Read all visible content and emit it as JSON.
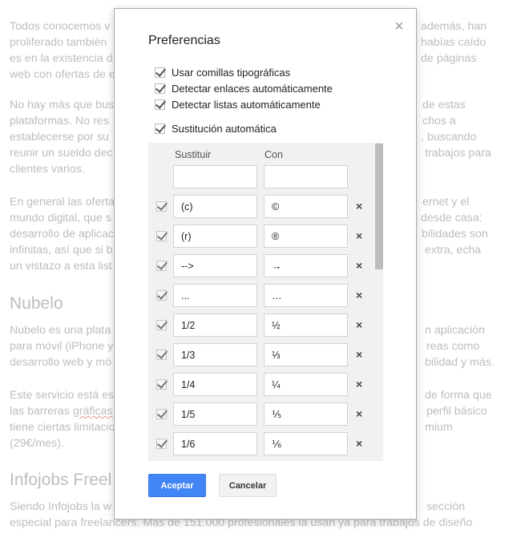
{
  "article": {
    "paragraphs": [
      "Todos conocemos v                                                            además, han proliferado también                                                  habías caído es en la existencia d                                             de páginas web con ofertas de e",
      "No hay más que bus                                                            de estas plataformas. No res                                                     chos a establecerse por su                                                     , buscando reunir un sueldo dec                                              trabajos para clientes varios.",
      "En general las oferta                                                          ernet y el mundo digital, que s                                                  desde casa: desarrollo de aplicac                                             bilidades son infinitas, así que si b                                         extra, echa un vistazo a esta list"
    ],
    "lines": [
      [
        "Todos conocemos v",
        "además, han"
      ],
      [
        "proliferado también",
        "habías caído"
      ],
      [
        "es en la existencia d",
        "de páginas"
      ],
      [
        "web con ofertas de e",
        ""
      ],
      [
        "No hay más que bus",
        "de estas"
      ],
      [
        "plataformas. No res",
        "chos a"
      ],
      [
        "establecerse por su",
        ", buscando"
      ],
      [
        "reunir un sueldo dec",
        "trabajos para"
      ],
      [
        "clientes varios.",
        ""
      ],
      [
        "En general las oferta",
        "ernet y el"
      ],
      [
        "mundo digital, que s",
        "desde casa:"
      ],
      [
        "desarrollo de aplicac",
        "bilidades son"
      ],
      [
        "infinitas, así que si b",
        "extra, echa"
      ],
      [
        "un vistazo a esta list",
        ""
      ],
      [
        "Nubelo es una plata",
        "n aplicación"
      ],
      [
        "para móvil (iPhone y",
        "reas como"
      ],
      [
        "desarrollo web y mó",
        "bilidad y más."
      ],
      [
        "Este servicio está es",
        "de forma que"
      ],
      [
        "las barreras gráficas",
        "perfil básico"
      ],
      [
        "tiene ciertas limitacio",
        "mium"
      ],
      [
        "(29€/mes).",
        ""
      ],
      [
        "Siendo Infojobs la w",
        "sección"
      ],
      [
        "especial para freelancers. Más de 151.000 profesionales la usan ya para trabajos de diseño",
        ""
      ]
    ],
    "heading_nubelo": "Nubelo",
    "heading_infojobs": "Infojobs Freel",
    "misspelled_word": "gráficas"
  },
  "dialog": {
    "title": "Preferencias",
    "close_icon": "close-icon",
    "options": [
      {
        "label": "Usar comillas tipográficas",
        "checked": true
      },
      {
        "label": "Detectar enlaces automáticamente",
        "checked": true
      },
      {
        "label": "Detectar listas automáticamente",
        "checked": true
      },
      {
        "label": "Sustitución automática",
        "checked": true
      }
    ],
    "substitutions": {
      "col_replace": "Sustituir",
      "col_with": "Con",
      "new_row": {
        "replace": "",
        "with": ""
      },
      "rows": [
        {
          "enabled": true,
          "replace": "(c)",
          "with": "©"
        },
        {
          "enabled": true,
          "replace": "(r)",
          "with": "®"
        },
        {
          "enabled": true,
          "replace": "-->",
          "with": "→"
        },
        {
          "enabled": true,
          "replace": "...",
          "with": "…"
        },
        {
          "enabled": true,
          "replace": "1/2",
          "with": "½"
        },
        {
          "enabled": true,
          "replace": "1/3",
          "with": "⅓"
        },
        {
          "enabled": true,
          "replace": "1/4",
          "with": "¼"
        },
        {
          "enabled": true,
          "replace": "1/5",
          "with": "⅕"
        },
        {
          "enabled": true,
          "replace": "1/6",
          "with": "⅙"
        }
      ],
      "delete_icon": "×"
    },
    "buttons": {
      "accept": "Aceptar",
      "cancel": "Cancelar"
    },
    "colors": {
      "accent": "#4285f4",
      "panel_bg": "#f1f1f1",
      "scrollbar": "#bdbdbd",
      "muted_text": "#bdbdbd"
    }
  }
}
